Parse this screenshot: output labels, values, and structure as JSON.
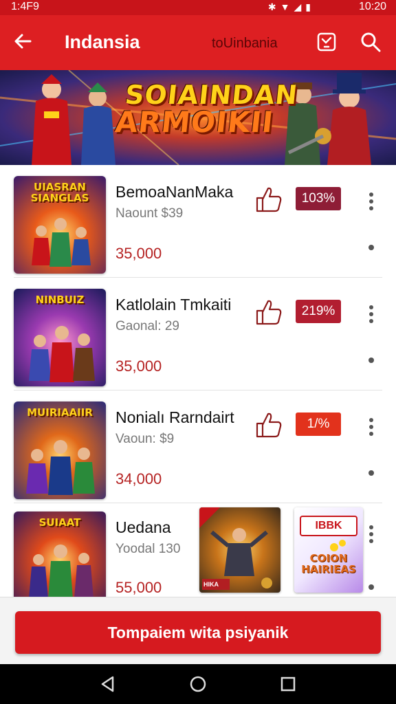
{
  "statusbar": {
    "time_left": "1:4F9",
    "time_right": "10:20",
    "icons": [
      "bluetooth-icon",
      "wifi-icon",
      "signal-icon",
      "battery-icon"
    ]
  },
  "appbar": {
    "title": "Indansia",
    "subtitle": "toUinbania",
    "icons": [
      "back-arrow-icon",
      "bookmark-icon",
      "search-icon"
    ],
    "color": "#dd1f22"
  },
  "banner": {
    "line1": "SOIAINDAN",
    "line2": "ARMOIKII"
  },
  "items": [
    {
      "thumb_title": "UIASRAN SIANGLAS",
      "name": "BemoaNanMaka",
      "sub": "Naount $39",
      "price": "35,000",
      "badge": "103%",
      "badge_color": "#8e1d36"
    },
    {
      "thumb_title": "NINBUIZ",
      "name": "Katlolain Tmkaiti",
      "sub": "Gaonal: 29",
      "price": "35,000",
      "badge": "219%",
      "badge_color": "#b21e30"
    },
    {
      "thumb_title": "MUIRIAAIIR",
      "name": "Nonialı Rarndairt",
      "sub": "Vaoun: $9",
      "price": "34,000",
      "badge": "1/%",
      "badge_color": "#e2321c"
    },
    {
      "thumb_title": "SUIAAT",
      "name": "Uedana",
      "sub": "Yoodal 130",
      "price": "55,000",
      "mini_a": "HIKA",
      "mini_b_top": "IBBK",
      "mini_b_bottom": "COION HAIRIEAS"
    }
  ],
  "cta": {
    "label": "Tompaiem wita psiyanik"
  },
  "navbar": {
    "icons": [
      "back-triangle-icon",
      "home-circle-icon",
      "recents-square-icon"
    ]
  }
}
